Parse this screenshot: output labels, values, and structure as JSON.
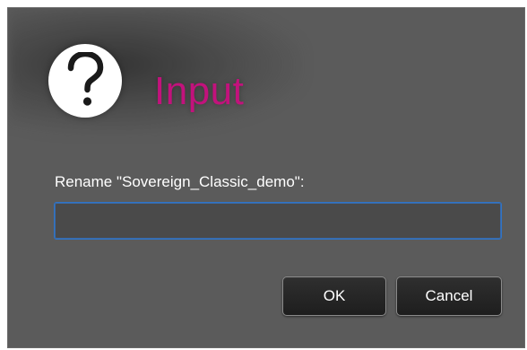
{
  "dialog": {
    "title": "Input",
    "icon": "question-icon",
    "title_color": "#c2127c",
    "prompt": "Rename \"Sovereign_Classic_demo\":",
    "input": {
      "value": "",
      "placeholder": ""
    },
    "buttons": {
      "ok_label": "OK",
      "cancel_label": "Cancel"
    },
    "colors": {
      "background": "#5b5b5b",
      "input_border": "#2f74c7",
      "button_background": "#1e1e1e"
    }
  }
}
